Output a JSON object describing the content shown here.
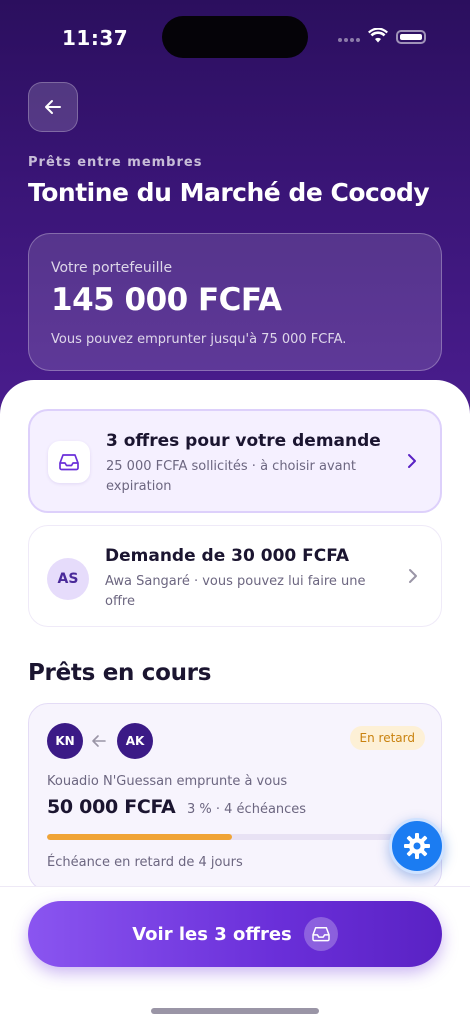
{
  "status_bar": {
    "time": "11:37"
  },
  "header": {
    "subtitle": "Prêts entre membres",
    "title": "Tontine du Marché de Cocody"
  },
  "wallet": {
    "label": "Votre portefeuille",
    "amount": "145 000 FCFA",
    "note": "Vous pouvez emprunter jusqu'à 75 000 FCFA."
  },
  "offers_card": {
    "title": "3 offres pour votre demande",
    "text": "25 000 FCFA sollicités · à choisir avant expiration",
    "icon": "inbox-icon"
  },
  "request_card": {
    "initials": "AS",
    "title": "Demande de 30 000 FCFA",
    "text": "Awa Sangaré · vous pouvez lui faire une offre"
  },
  "loans_section": {
    "title": "Prêts en cours",
    "items": [
      {
        "lender_initials": "KN",
        "borrower_initials": "AK",
        "badge": "En retard",
        "description": "Kouadio N'Guessan emprunte à vous",
        "amount": "50 000 FCFA",
        "terms": "3 % · 4 échéances",
        "progress": 0.5,
        "due": "Échéance en retard de 4 jours"
      }
    ]
  },
  "fab": {
    "icon": "gear-icon",
    "color": "#1b7cf2"
  },
  "cta": {
    "label": "Voir les 3 offres",
    "icon": "inbox-icon"
  },
  "colors": {
    "accent": "#6a2fd9",
    "header": "#3a1577",
    "late": "#f0a436"
  }
}
